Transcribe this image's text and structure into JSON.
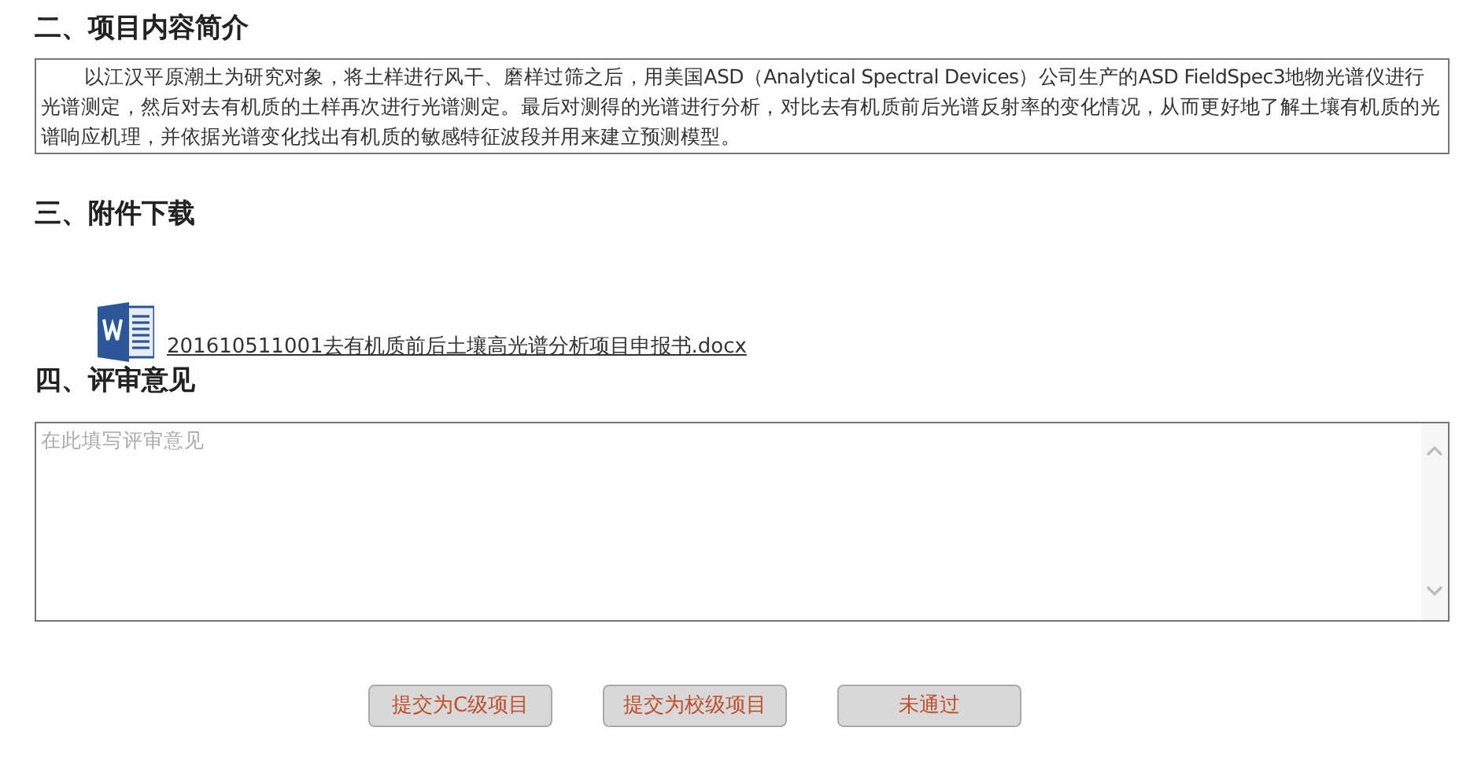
{
  "sections": [
    {
      "kind": "text",
      "heading": "二、项目内容简介",
      "body": "以江汉平原潮土为研究对象，将土样进行风干、磨样过筛之后，用美国ASD（Analytical Spectral Devices）公司生产的ASD FieldSpec3地物光谱仪进行光谱测定，然后对去有机质的土样再次进行光谱测定。最后对测得的光谱进行分析，对比去有机质前后光谱反射率的变化情况，从而更好地了解土壤有机质的光谱响应机理，并依据光谱变化找出有机质的敏感特征波段并用来建立预测模型。"
    },
    {
      "kind": "attachment",
      "heading": "三、附件下载",
      "file": "201610511001去有机质前后土壤高光谱分析项目申报书.docx"
    },
    {
      "kind": "review",
      "heading": "四、评审意见",
      "placeholder": "在此填写评审意见"
    }
  ],
  "buttons": [
    "提交为C级项目",
    "提交为校级项目",
    "未通过"
  ]
}
